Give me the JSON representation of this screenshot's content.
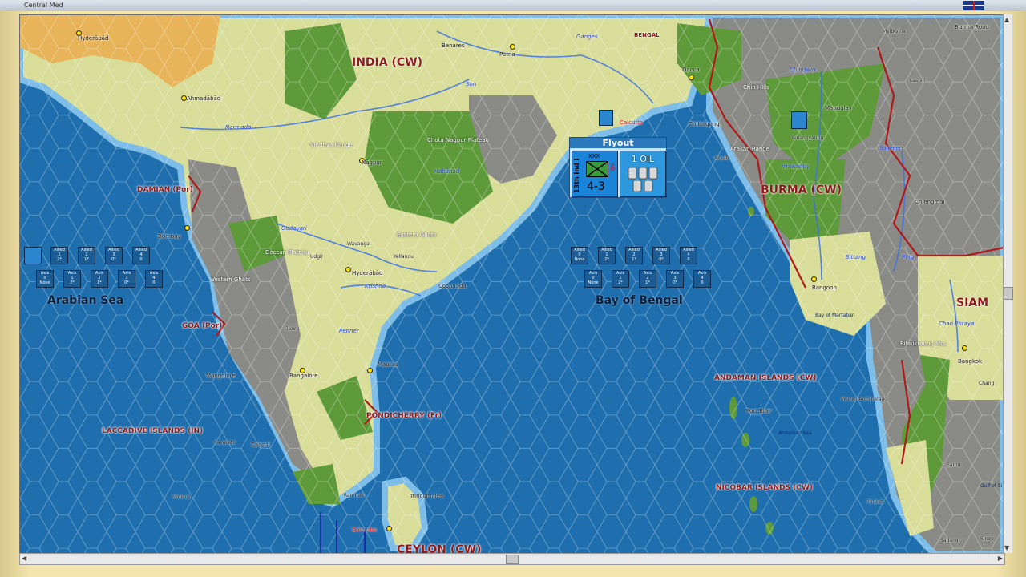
{
  "window": {
    "title": "Central Med"
  },
  "flyout": {
    "title": "Flyout",
    "unit1": {
      "name": "13th Ind I",
      "size": "XXX",
      "strength": "4-3",
      "nation": "IND"
    },
    "unit2": {
      "label": "1 OIL"
    }
  },
  "regions": {
    "india": "INDIA (CW)",
    "burma": "BURMA (CW)",
    "siam": "SIAM",
    "ceylon": "CEYLON (CW)",
    "bengal": "BENGAL",
    "damian": "DAMIAN (Por)",
    "goa": "GOA (Por)",
    "pondicherry": "PONDICHERRY (Fr)",
    "laccadive": "LACCADIVE ISLANDS (IN)",
    "andaman": "ANDAMAN ISLANDS (CW)",
    "nicobar": "NICOBAR ISLANDS (CW)"
  },
  "seas": {
    "arabian": "Arabian Sea",
    "bengal_bay": "Bay of Bengal",
    "martaban": "Bay of Martaban",
    "andaman_sea": "Andaman Sea",
    "gulf": "Gulf of Si"
  },
  "cities": {
    "hyderabad_n": "Hyderābād",
    "ahmadabad": "Ahmadābād",
    "benares": "Benares",
    "patna": "Patna",
    "dacca": "Dacca",
    "calcutta": "Calcutta",
    "chittagong": "Chittagong",
    "akyab": "Akyab",
    "nagpur": "Nāgpur",
    "bombay": "Bombay",
    "wavangal": "Wavangal",
    "yellandu": "Yellandu",
    "udgir": "Udgir",
    "hyderabad_s": "Hyderābād",
    "cocanada": "Cocanada",
    "goorg": "Goorg",
    "madras": "Madras",
    "bangalore": "Bangalore",
    "mangalore": "Mangalore",
    "calicut": "Calicut",
    "kavaratti": "Kavaratti",
    "minicoy": "Minicoy",
    "ramnad": "Ramnad",
    "trincomalee": "Trincomalee",
    "colombo": "Colombo",
    "rangoon": "Rangoon",
    "port_blair": "Port Blair",
    "bangkok": "Bangkok",
    "mandalay": "Mandalay",
    "yenangyaung": "Yenangyaung",
    "myitkyina": "Myitkyina",
    "burma_road": "Burma Road",
    "lashio": "Lashio",
    "chiengmai": "Chiengmai",
    "chang": "Chang",
    "mergui": "Mergui Archipelago",
    "phuket": "Phuket",
    "samui": "Samui",
    "sadang": "Sadang",
    "singora": "Singo"
  },
  "rivers": {
    "ganges": "Ganges",
    "son": "Son",
    "narmada": "Narmada",
    "mahanad": "Mahānad",
    "godavari": "Godavari",
    "krishna": "Krishna",
    "penner": "Penner",
    "chindwin": "Chindwin",
    "irrawaddy": "Irrawaddy",
    "salween": "Salween",
    "sittang": "Sittang",
    "ping": "Ping",
    "chao_phraya": "Chao Phraya"
  },
  "terrain": {
    "vindhya": "Vindhya Range",
    "chota": "Chota Nagpur Plateau",
    "eastern_ghats": "Eastern Ghats",
    "deccan": "Deccan Plateau",
    "western_ghats": "Western Ghats",
    "chin_hills": "Chin Hills",
    "arakan": "Arakan Range",
    "bilauktaung": "Bilauktaung Mts"
  },
  "sea_boxes": {
    "arabian_allied": [
      {
        "side": "Allied",
        "num": "1",
        "val": "2*"
      },
      {
        "side": "Allied",
        "num": "2",
        "val": "1*"
      },
      {
        "side": "Allied",
        "num": "3",
        "val": "0*"
      },
      {
        "side": "Allied",
        "num": "4",
        "val": "0"
      }
    ],
    "arabian_axis": [
      {
        "side": "Axis",
        "num": "0",
        "val": "None"
      },
      {
        "side": "Axis",
        "num": "1",
        "val": "2*"
      },
      {
        "side": "Axis",
        "num": "2",
        "val": "1*"
      },
      {
        "side": "Axis",
        "num": "3",
        "val": "0*"
      },
      {
        "side": "Axis",
        "num": "4",
        "val": "0"
      }
    ],
    "bengal_allied": [
      {
        "side": "Allied",
        "num": "0",
        "val": "None"
      },
      {
        "side": "Allied",
        "num": "1",
        "val": "2*"
      },
      {
        "side": "Allied",
        "num": "2",
        "val": "1*"
      },
      {
        "side": "Allied",
        "num": "3",
        "val": "0*"
      },
      {
        "side": "Allied",
        "num": "4",
        "val": "0"
      }
    ],
    "bengal_axis": [
      {
        "side": "Axis",
        "num": "0",
        "val": "None"
      },
      {
        "side": "Axis",
        "num": "1",
        "val": "2*"
      },
      {
        "side": "Axis",
        "num": "2",
        "val": "1*"
      },
      {
        "side": "Axis",
        "num": "3",
        "val": "0*"
      },
      {
        "side": "Axis",
        "num": "4",
        "val": "0"
      }
    ]
  },
  "colors": {
    "sea": "#1f6fae",
    "coast": "#7dbde8",
    "plain": "#d9dd9a",
    "forest": "#5e9a3a",
    "mountain": "#8a8a86",
    "desert": "#e7b45a",
    "border": "#b01a1a"
  }
}
